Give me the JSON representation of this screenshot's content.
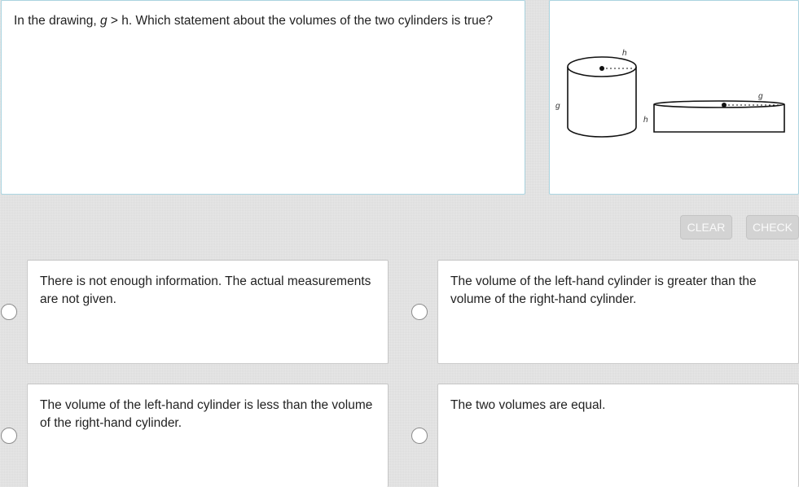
{
  "question": {
    "prefix": "In the drawing, ",
    "var_g": "g",
    "middle": " > h. Which statement about the volumes of the two cylinders is true?"
  },
  "figure": {
    "left_cylinder": {
      "top_label": "h",
      "side_label": "g"
    },
    "right_cylinder": {
      "top_label": "g",
      "side_label": "h"
    }
  },
  "buttons": {
    "clear": "CLEAR",
    "check": "CHECK"
  },
  "choices": [
    {
      "text": "There is not enough information. The actual measurements are not given.",
      "selected": false
    },
    {
      "text": "The volume of the left-hand cylinder is greater than the volume of the right-hand cylinder.",
      "selected": false
    },
    {
      "text": "The volume of the left-hand cylinder is less than the volume of the right-hand cylinder.",
      "selected": false
    },
    {
      "text": "The two volumes are equal.",
      "selected": false
    }
  ]
}
